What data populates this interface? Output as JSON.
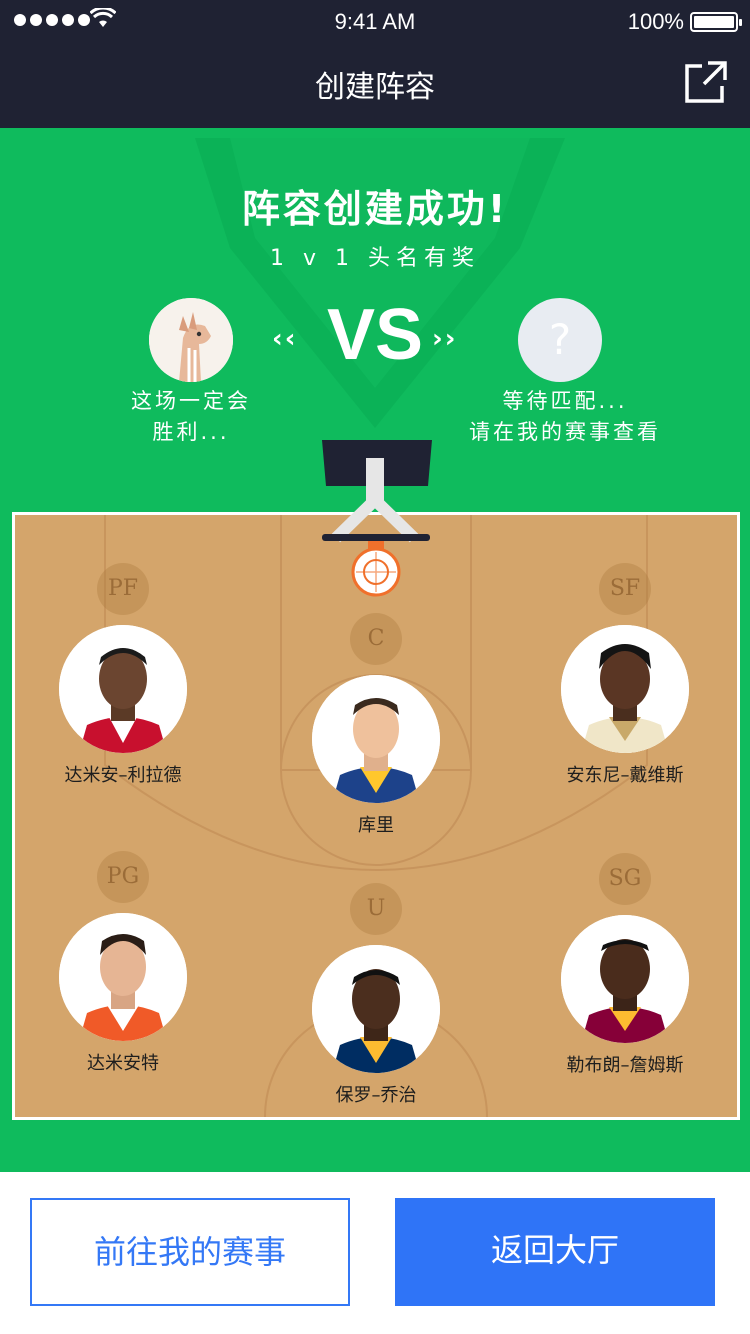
{
  "status_bar": {
    "time": "9:41 AM",
    "battery": "100%"
  },
  "nav": {
    "title": "创建阵容",
    "share_icon": "share-icon"
  },
  "banner": {
    "headline": "阵容创建成功!",
    "subline": "1 v 1 头名有奖",
    "vs": "VS",
    "left_chevrons": "‹‹",
    "right_chevrons": "››"
  },
  "me": {
    "label_line1": "这场一定会",
    "label_line2": "胜利..."
  },
  "opponent": {
    "icon": "?",
    "label_line1": "等待匹配...",
    "label_line2": "请在我的赛事查看"
  },
  "players": {
    "pf": {
      "position": "PF",
      "name": "达米安–利拉德"
    },
    "c": {
      "position": "C",
      "name": "库里"
    },
    "sf": {
      "position": "SF",
      "name": "安东尼–戴维斯"
    },
    "pg": {
      "position": "PG",
      "name": "达米安特"
    },
    "u": {
      "position": "U",
      "name": "保罗–乔治"
    },
    "sg": {
      "position": "SG",
      "name": "勒布朗–詹姆斯"
    }
  },
  "buttons": {
    "my_matches": "前往我的赛事",
    "back_lobby": "返回大厅"
  },
  "colors": {
    "nav_bg": "#1f2233",
    "arena_green": "#0fbb5d",
    "court": "#d4a56b",
    "primary_blue": "#2f74f7"
  }
}
